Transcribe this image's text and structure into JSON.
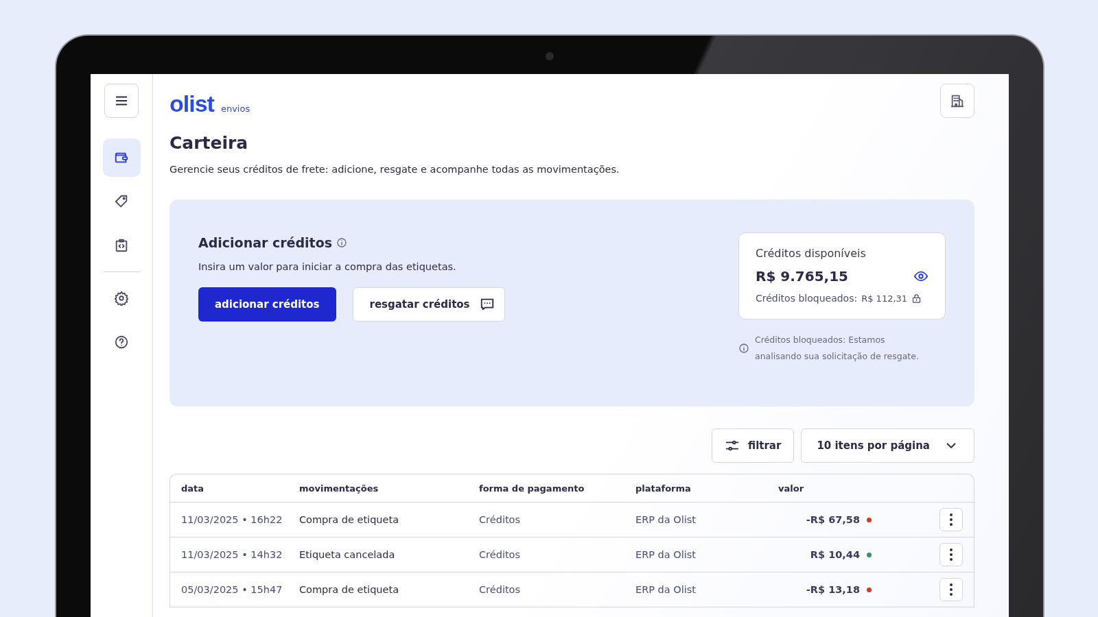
{
  "sidebar": {
    "items": [
      {
        "selected": true
      },
      {
        "selected": false
      },
      {
        "selected": false
      },
      {
        "selected": false
      },
      {
        "selected": false
      }
    ]
  },
  "logo": {
    "wordmark": "olist",
    "product": "envios"
  },
  "page": {
    "title": "Carteira",
    "subtitle": "Gerencie seus créditos de frete: adicione, resgate e acompanhe todas as movimentações."
  },
  "add_credits": {
    "title": "Adicionar créditos",
    "description": "Insira um valor para iniciar a compra das etiquetas.",
    "primary_button": "adicionar créditos",
    "secondary_button": "resgatar créditos"
  },
  "balance": {
    "label": "Créditos disponíveis",
    "amount": "R$ 9.765,15",
    "blocked_label": "Créditos bloqueados:",
    "blocked_amount": "R$ 112,31",
    "note": "Créditos bloqueados: Estamos analisando sua solicitação de resgate."
  },
  "toolbar": {
    "filter_button": "filtrar",
    "page_size": "10 itens por página"
  },
  "table": {
    "columns": [
      "data",
      "movimentações",
      "forma de pagamento",
      "plataforma",
      "valor"
    ],
    "rows": [
      {
        "date": "11/03/2025 • 16h22",
        "movement": "Compra de etiqueta",
        "payment": "Créditos",
        "platform": "ERP da Olist",
        "value": "-R$ 67,58",
        "color": "#d9381e"
      },
      {
        "date": "11/03/2025 • 14h32",
        "movement": "Etiqueta cancelada",
        "payment": "Créditos",
        "platform": "ERP da Olist",
        "value": "R$ 10,44",
        "color": "#2e9a5c"
      },
      {
        "date": "05/03/2025 • 15h47",
        "movement": "Compra de etiqueta",
        "payment": "Créditos",
        "platform": "ERP da Olist",
        "value": "-R$ 13,18",
        "color": "#d9381e"
      }
    ]
  }
}
